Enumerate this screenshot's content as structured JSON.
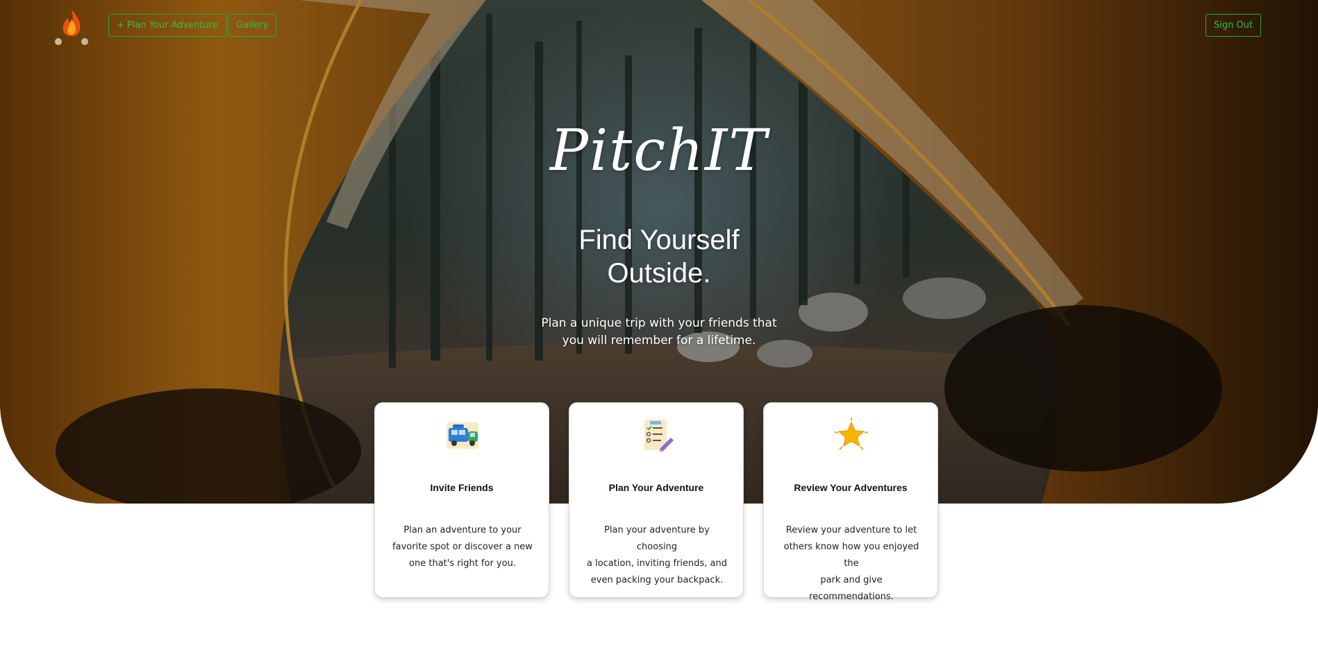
{
  "nav": {
    "logo_icon": "campfire-icon",
    "plan_label": "+ Plan Your Adventure",
    "gallery_label": "Gallery",
    "signout_label": "Sign Out",
    "accent_color": "#28a745"
  },
  "hero": {
    "brand": "PitchIT",
    "tagline_line1": "Find Yourself",
    "tagline_line2": "Outside.",
    "subline_line1": "Plan a unique trip with your friends that",
    "subline_line2": "you will remember for a lifetime.",
    "background": "tent-forest-photo"
  },
  "features": [
    {
      "icon": "camper-van-icon",
      "title": "Invite Friends",
      "lines": [
        "Plan an adventure to your",
        "favorite spot or discover a new",
        "one that's right for you."
      ]
    },
    {
      "icon": "checklist-icon",
      "title": "Plan Your Adventure",
      "lines": [
        "Plan your adventure by choosing",
        "a location, inviting friends, and",
        "even packing your backpack."
      ]
    },
    {
      "icon": "star-icon",
      "title": "Review Your Adventures",
      "lines": [
        "Review your adventure to let",
        "others know how you enjoyed the",
        "park and give recommendations."
      ]
    }
  ]
}
